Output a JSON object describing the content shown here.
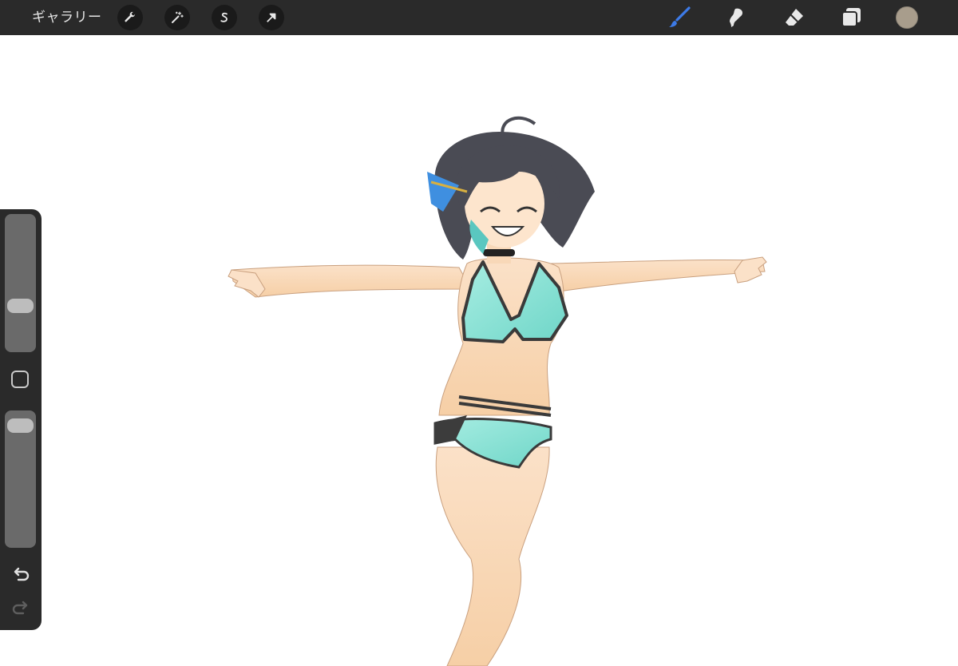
{
  "topbar": {
    "gallery_label": "ギャラリー",
    "actions": [
      {
        "name": "actions-wrench",
        "icon": "wrench-icon"
      },
      {
        "name": "adjustments",
        "icon": "magic-wand-icon"
      },
      {
        "name": "selection",
        "icon": "selection-s-icon"
      },
      {
        "name": "transform",
        "icon": "arrow-cursor-icon"
      }
    ],
    "tools": [
      {
        "name": "brush",
        "icon": "brush-icon",
        "active": true,
        "color": "#3d7be8"
      },
      {
        "name": "smudge",
        "icon": "smudge-icon",
        "active": false
      },
      {
        "name": "eraser",
        "icon": "eraser-icon",
        "active": false
      },
      {
        "name": "layers",
        "icon": "layers-icon",
        "active": false
      }
    ],
    "current_color": "#a89d8c"
  },
  "sidebar": {
    "brush_size_level": 0.31,
    "opacity_level": 0.95,
    "modify_button": "square-icon",
    "undo_icon": "undo-icon",
    "redo_icon": "redo-icon",
    "redo_enabled": false
  },
  "canvas": {
    "background": "#ffffff",
    "content": "illustration"
  }
}
